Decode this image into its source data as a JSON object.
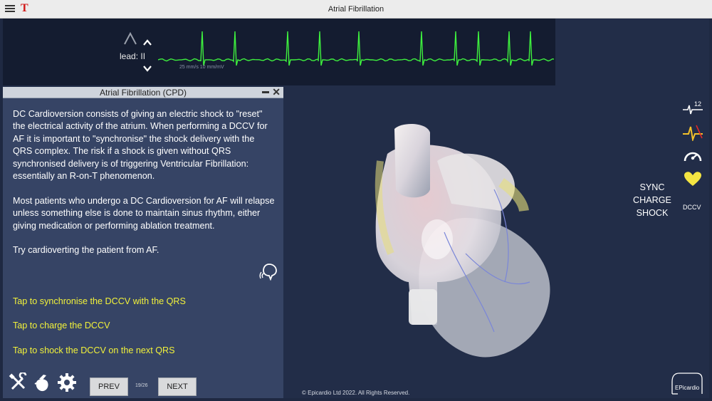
{
  "app": {
    "title": "Atrial Fibrillation",
    "logo_letter": "T"
  },
  "ecg": {
    "lead_label": "lead: II",
    "scale_text": "25 mm/s  10 mm/mV",
    "trace_color": "#3ef03e"
  },
  "cpd": {
    "title": "Atrial Fibrillation (CPD)",
    "paragraphs": [
      "DC Cardioversion consists of giving an electric shock to \"reset\" the electrical activity of the atrium.  When performing a DCCV for AF it is important to \"synchronise\" the shock delivery with the QRS complex.  The risk if a shock is given without QRS synchronised delivery is of triggering Ventricular Fibrillation: essentially an R-on-T phenomenon.",
      "Most patients who undergo a DC Cardioversion for AF will relapse unless something else is done to maintain sinus rhythm, either giving medication or performing ablation treatment.",
      "Try cardioverting the patient from AF."
    ],
    "tap_sync": "Tap to synchronise the DCCV with the QRS",
    "tap_charge": "Tap to charge the DCCV",
    "tap_shock": "Tap to shock the DCCV on the next QRS",
    "prev_label": "PREV",
    "next_label": "NEXT",
    "page_counter": "19/26",
    "link_color": "#f2f23a"
  },
  "right_panel": {
    "ecg12_badge": "12",
    "dccv_label": "DCCV",
    "sync_label": "SYNC",
    "charge_label": "CHARGE",
    "shock_label": "SHOCK",
    "heart_icon_color": "#f4e542"
  },
  "footer": {
    "copyright": "© Epicardio Ltd 2022. All Rights Reserved.",
    "logo_text": "EPicardio"
  }
}
